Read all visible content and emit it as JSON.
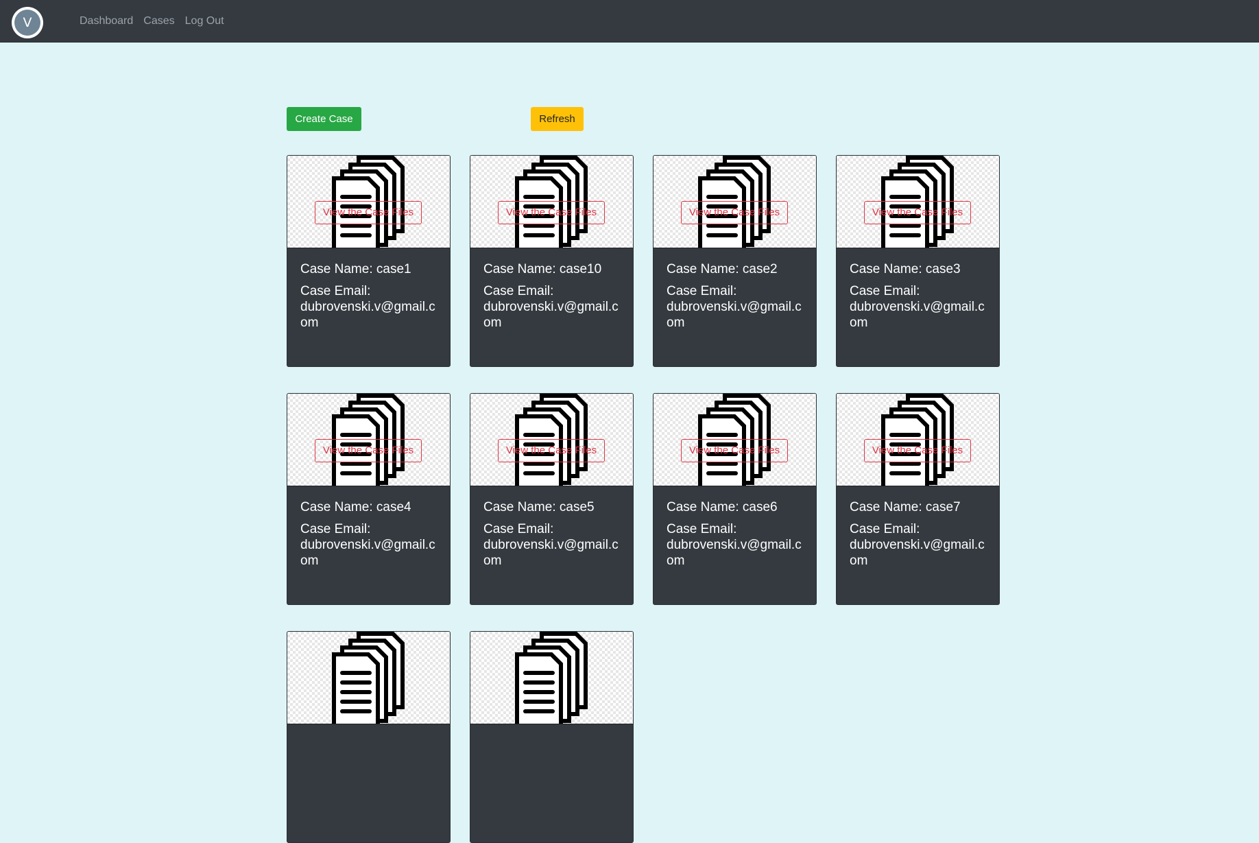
{
  "nav": {
    "brand_letter": "V",
    "links": [
      {
        "label": "Dashboard"
      },
      {
        "label": "Cases"
      },
      {
        "label": "Log Out"
      }
    ]
  },
  "toolbar": {
    "create_label": "Create Case",
    "refresh_label": "Refresh"
  },
  "colors": {
    "navbar": "#343a40",
    "page_background": "#dff4f6",
    "create_button": "#28a745",
    "refresh_button": "#ffc107",
    "view_button_outline": "#dc3545",
    "card_background": "#343a40"
  },
  "card_icon": "document-stack-icon",
  "cases": [
    {
      "name_label": "Case Name: case1",
      "email_label": "Case Email:",
      "email": "dubrovenski.v@gmail.com",
      "view_label": "View the Case Files"
    },
    {
      "name_label": "Case Name: case10",
      "email_label": "Case Email:",
      "email": "dubrovenski.v@gmail.com",
      "view_label": "View the Case Files"
    },
    {
      "name_label": "Case Name: case2",
      "email_label": "Case Email:",
      "email": "dubrovenski.v@gmail.com",
      "view_label": "View the Case Files"
    },
    {
      "name_label": "Case Name: case3",
      "email_label": "Case Email:",
      "email": "dubrovenski.v@gmail.com",
      "view_label": "View the Case Files"
    },
    {
      "name_label": "Case Name: case4",
      "email_label": "Case Email:",
      "email": "dubrovenski.v@gmail.com",
      "view_label": "View the Case Files"
    },
    {
      "name_label": "Case Name: case5",
      "email_label": "Case Email:",
      "email": "dubrovenski.v@gmail.com",
      "view_label": "View the Case Files"
    },
    {
      "name_label": "Case Name: case6",
      "email_label": "Case Email:",
      "email": "dubrovenski.v@gmail.com",
      "view_label": "View the Case Files"
    },
    {
      "name_label": "Case Name: case7",
      "email_label": "Case Email:",
      "email": "dubrovenski.v@gmail.com",
      "view_label": "View the Case Files"
    },
    {
      "name_label": "",
      "email_label": "",
      "email": "",
      "view_label": ""
    },
    {
      "name_label": "",
      "email_label": "",
      "email": "",
      "view_label": ""
    }
  ]
}
